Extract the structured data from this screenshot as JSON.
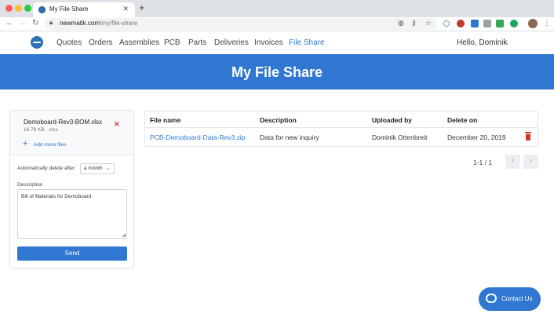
{
  "browser": {
    "tab_title": "My File Share",
    "tab_close": "✕",
    "new_tab": "+",
    "url_host": "newmatik.com",
    "url_path": "/my/file-share"
  },
  "nav": {
    "links": [
      "Quotes",
      "Orders",
      "Assemblies",
      "PCB",
      "Parts",
      "Deliveries",
      "Invoices",
      "File Share"
    ],
    "active": "File Share",
    "greeting": "Hello, Dominik"
  },
  "banner": {
    "title": "My File Share"
  },
  "upload": {
    "file_name": "Demoboard-Rev3-BOM.xlsx",
    "file_size": "16.78 KB",
    "file_type": "xlsx",
    "add_more": "Add more files",
    "auto_delete_label": "Automatically delete after",
    "auto_delete_value": "a month",
    "description_label": "Description",
    "description_value": "Bill of Materials for Demoboard",
    "send_label": "Send"
  },
  "table": {
    "headers": [
      "File name",
      "Description",
      "Uploaded by",
      "Delete on"
    ],
    "rows": [
      {
        "file_name": "PCB-Demoboard-Data-Rev3.zip",
        "description": "Data for new inquiry",
        "uploaded_by": "Dominik Ottenbreit",
        "delete_on": "December 20, 2019"
      }
    ]
  },
  "pager": {
    "text": "1-1 / 1"
  },
  "contact": {
    "label": "Contact Us"
  },
  "colors": {
    "accent": "#2f77d0",
    "danger": "#d0352c"
  }
}
